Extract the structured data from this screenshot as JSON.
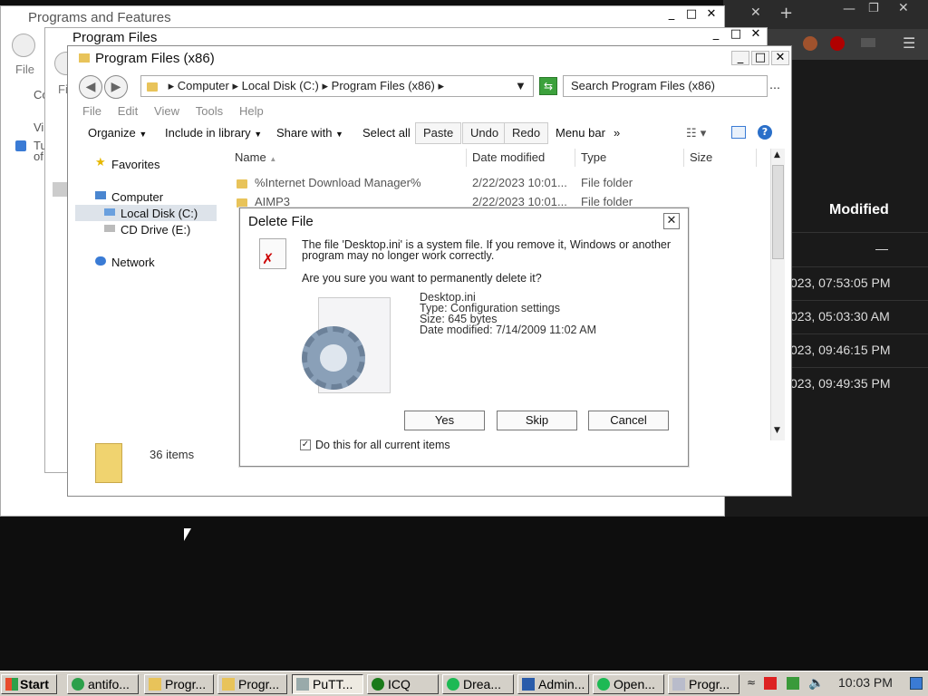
{
  "browser": {
    "column_header": "Modified",
    "rows": [
      "—",
      "023, 07:53:05 PM",
      "023, 05:03:30 AM",
      "023, 09:46:15 PM",
      "023, 09:49:35 PM"
    ]
  },
  "win_back": {
    "title": "Programs and Features",
    "menu_file": "File",
    "side1": "Co",
    "side2": "Vi",
    "side3a": "Tu",
    "side3b": "of"
  },
  "win_mid": {
    "title": "Program Files",
    "menu_file": "Fi"
  },
  "explorer": {
    "title": "Program Files (x86)",
    "breadcrumb": [
      "Computer",
      "Local Disk (C:)",
      "Program Files (x86)"
    ],
    "search_placeholder": "Search Program Files (x86)",
    "menu": [
      "File",
      "Edit",
      "View",
      "Tools",
      "Help"
    ],
    "commands": {
      "organize": "Organize",
      "include": "Include in library",
      "share": "Share with",
      "select_all": "Select all",
      "paste": "Paste",
      "undo": "Undo",
      "redo": "Redo",
      "menu_bar": "Menu bar",
      "more": "»"
    },
    "nav": {
      "favorites": "Favorites",
      "computer": "Computer",
      "local_disk": "Local Disk (C:)",
      "cd_drive": "CD Drive (E:)",
      "network": "Network"
    },
    "columns": {
      "name": "Name",
      "date": "Date modified",
      "type": "Type",
      "size": "Size"
    },
    "files": [
      {
        "name": "%Internet Download Manager%",
        "date": "2/22/2023 10:01...",
        "type": "File folder"
      },
      {
        "name": "AIMP3",
        "date": "2/22/2023 10:01...",
        "type": "File folder"
      }
    ],
    "status": "36 items"
  },
  "dialog": {
    "title": "Delete File",
    "message": "The file 'Desktop.ini' is a system file. If you remove it, Windows or another program may no longer work correctly.",
    "question": "Are you sure you want to permanently delete it?",
    "file_name": "Desktop.ini",
    "file_type": "Type: Configuration settings",
    "file_size": "Size: 645 bytes",
    "file_date": "Date modified: 7/14/2009 11:02 AM",
    "yes": "Yes",
    "skip": "Skip",
    "cancel": "Cancel",
    "checkbox_label": "Do this for all current items",
    "checkbox_checked": true
  },
  "taskbar": {
    "start": "Start",
    "tasks": [
      "antifo...",
      "Progr...",
      "Progr...",
      "PuTT...",
      "ICQ",
      "Drea...",
      "Admin...",
      "Open...",
      "Progr..."
    ],
    "clock": "10:03 PM"
  },
  "colors": {
    "accent_green": "#3ca13c",
    "title_text": "#111111",
    "taskbar": "#d4d0c8"
  }
}
